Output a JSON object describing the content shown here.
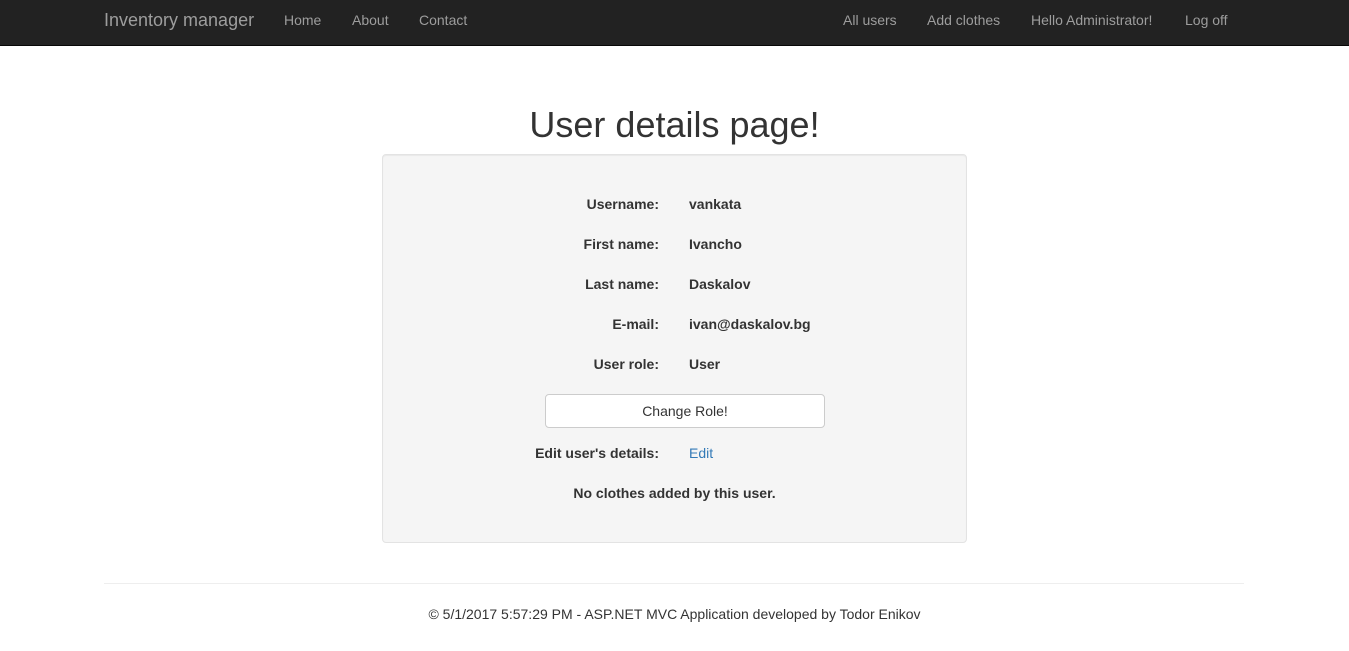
{
  "navbar": {
    "brand": "Inventory manager",
    "left_links": [
      "Home",
      "About",
      "Contact"
    ],
    "right_links": [
      "All users",
      "Add clothes",
      "Hello Administrator!",
      "Log off"
    ],
    "background": "#222222",
    "link_color": "#9d9d9d"
  },
  "main": {
    "title": "User details page!",
    "details": [
      {
        "label": "Username:",
        "value": "vankata"
      },
      {
        "label": "First name:",
        "value": "Ivancho"
      },
      {
        "label": "Last name:",
        "value": "Daskalov"
      },
      {
        "label": "E-mail:",
        "value": "ivan@daskalov.bg"
      },
      {
        "label": "User role:",
        "value": "User"
      }
    ],
    "change_role_button": "Change Role!",
    "edit_label": "Edit user's details:",
    "edit_link": "Edit",
    "no_clothes_message": "No clothes added by this user."
  },
  "footer": {
    "text": "© 5/1/2017 5:57:29 PM - ASP.NET MVC Application developed by Todor Enikov"
  }
}
